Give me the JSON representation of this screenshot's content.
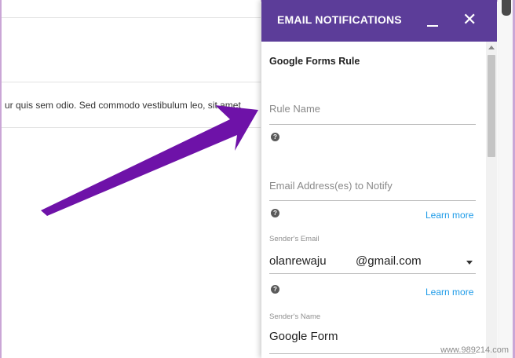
{
  "background": {
    "form_text": "ur quis sem odio. Sed commodo vestibulum leo, sit amet"
  },
  "panel": {
    "title": "EMAIL NOTIFICATIONS",
    "section_title": "Google Forms Rule",
    "rule_name_placeholder": "Rule Name",
    "email_to_notify_placeholder": "Email Address(es) to Notify",
    "learn_more": "Learn more",
    "sender_email_label": "Sender's Email",
    "sender_email_value": "olanrewaju     @gmail.com",
    "sender_name_label": "Sender's Name",
    "sender_name_value": "Google Form"
  },
  "icons": {
    "help": "question-circle-icon",
    "minimize": "minimize-icon",
    "close": "close-icon",
    "dropdown": "chevron-down-icon"
  },
  "colors": {
    "header_bg": "#5c3d99",
    "arrow": "#6e12a8",
    "link": "#1e9be8"
  },
  "watermark": "www.989214.com"
}
